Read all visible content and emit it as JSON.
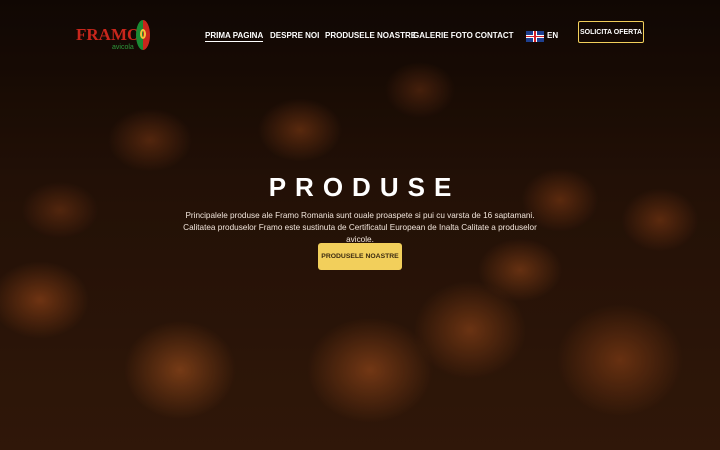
{
  "nav": {
    "logo": {
      "brand": "FRAMO",
      "sub": "avicola"
    },
    "menu": [
      {
        "label": "PRIMA PAGINA",
        "active": true
      },
      {
        "label": "DESPRE NOI"
      },
      {
        "label": "PRODUSELE NOASTRE"
      },
      {
        "label": "GALERIE FOTO"
      },
      {
        "label": "CONTACT"
      }
    ],
    "language": {
      "label": "EN",
      "icon": "uk-flag-icon"
    },
    "cta_label": "SOLICITA OFERTA"
  },
  "hero": {
    "title": "PRODUSE",
    "description": "Principalele produse ale Framo Romania sunt ouale proaspete si pui cu varsta de 16 saptamani. Calitatea produselor Framo este sustinuta de Certificatul European de Inalta Calitate a produselor avicole.",
    "button_label": "PRODUSELE NOASTRE"
  },
  "colors": {
    "accent": "#f2cf5b",
    "logo_red": "#c8261c",
    "logo_green": "#2e9a3c"
  }
}
